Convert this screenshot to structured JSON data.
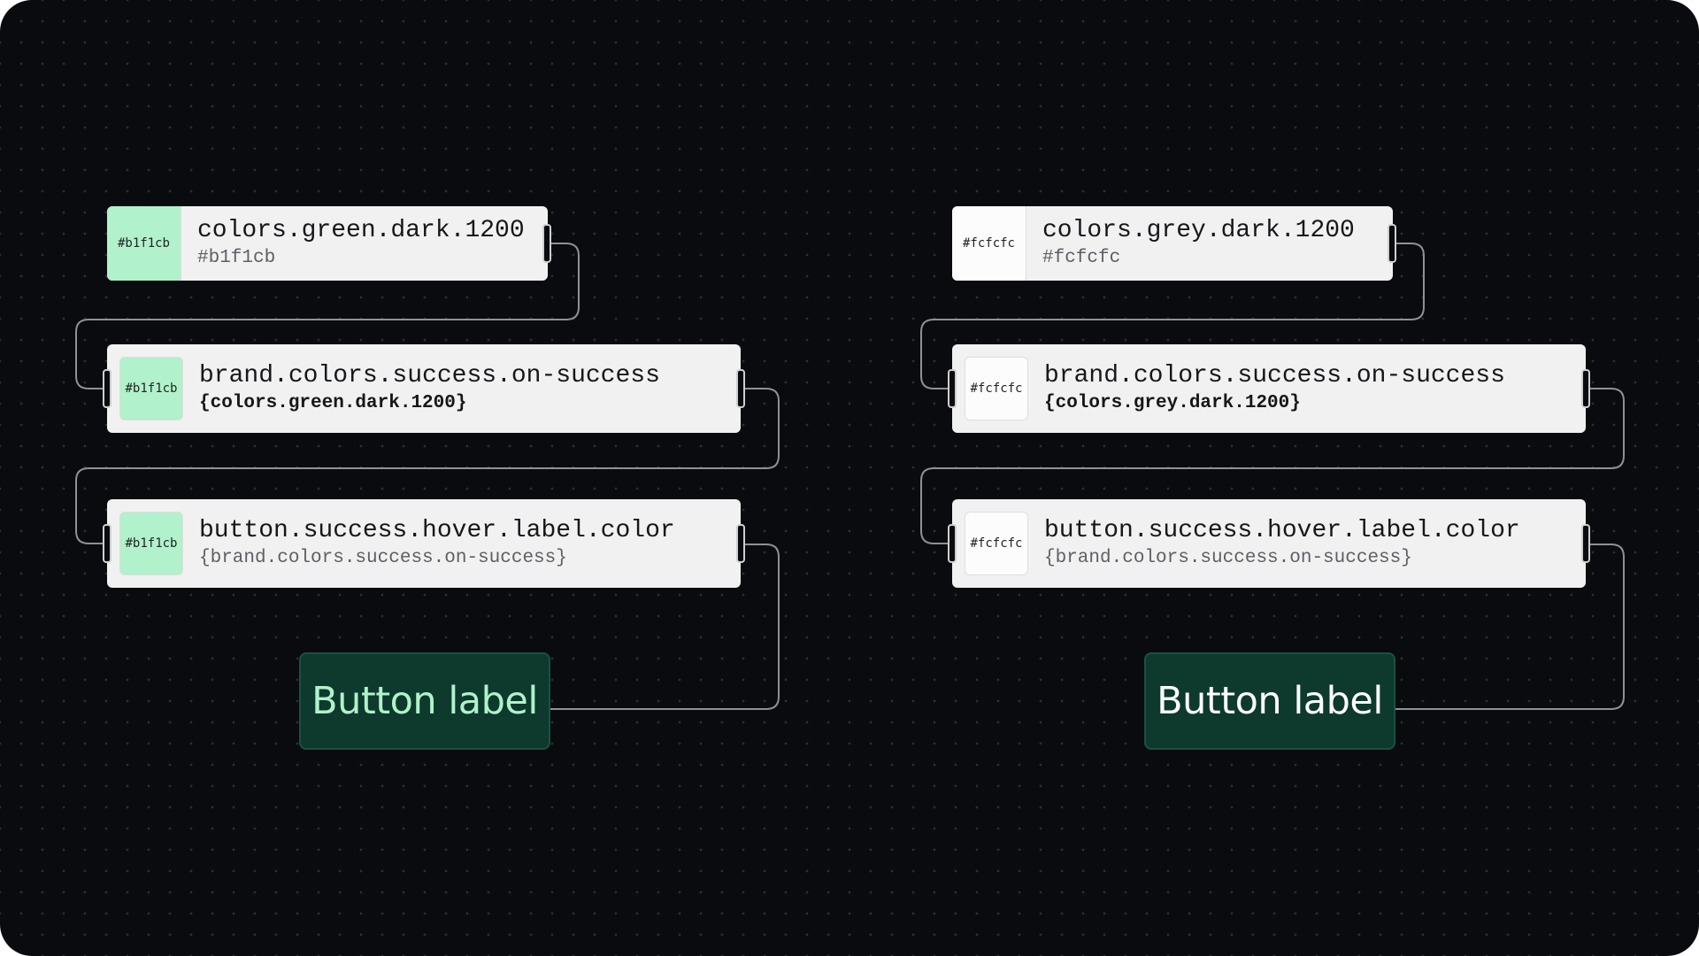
{
  "colors": {
    "canvas_bg": "#0a0b0e",
    "card_bg": "#f1f1f1",
    "connector": "#8e9196",
    "button_bg": "#0d3a2d",
    "button_border": "#1a5140",
    "green_swatch": "#b1f1cb",
    "grey_swatch": "#fcfcfc"
  },
  "left": {
    "source": {
      "swatch_label": "#b1f1cb",
      "name": "colors.green.dark.1200",
      "value": "#b1f1cb"
    },
    "brand": {
      "swatch_label": "#b1f1cb",
      "name": "brand.colors.success.on-success",
      "value": "{colors.green.dark.1200}"
    },
    "component": {
      "swatch_label": "#b1f1cb",
      "name": "button.success.hover.label.color",
      "value": "{brand.colors.success.on-success}"
    },
    "button": {
      "label": "Button label",
      "label_color": "#b1f1cb"
    }
  },
  "right": {
    "source": {
      "swatch_label": "#fcfcfc",
      "name": "colors.grey.dark.1200",
      "value": "#fcfcfc"
    },
    "brand": {
      "swatch_label": "#fcfcfc",
      "name": "brand.colors.success.on-success",
      "value": "{colors.grey.dark.1200}"
    },
    "component": {
      "swatch_label": "#fcfcfc",
      "name": "button.success.hover.label.color",
      "value": "{brand.colors.success.on-success}"
    },
    "button": {
      "label": "Button label",
      "label_color": "#fcfcfc"
    }
  }
}
